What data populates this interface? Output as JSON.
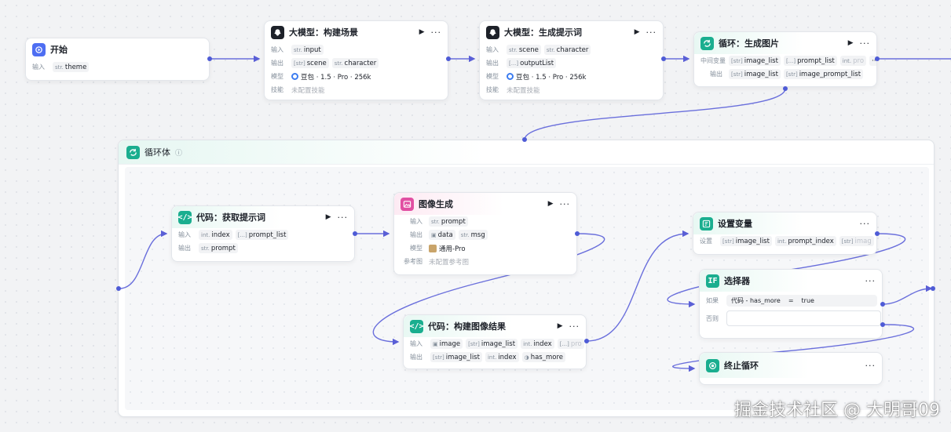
{
  "nodes": {
    "start": {
      "title": "开始",
      "input_label": "输入",
      "input_type": "str.",
      "input_var": "theme"
    },
    "llm_scene": {
      "title": "大模型：构建场景",
      "input_label": "输入",
      "input_type": "str.",
      "input_var": "input",
      "output_label": "输出",
      "out1_type": "[str]",
      "out1_var": "scene",
      "out2_type": "str.",
      "out2_var": "character",
      "model_label": "模型",
      "model": "豆包 · 1.5 · Pro · 256k",
      "skill_label": "技能",
      "skill": "未配置技能"
    },
    "llm_prompt": {
      "title": "大模型：生成提示词",
      "input_label": "输入",
      "in1_type": "str.",
      "in1_var": "scene",
      "in2_type": "str.",
      "in2_var": "character",
      "output_label": "输出",
      "out_type": "[...]",
      "out_var": "outputList",
      "model_label": "模型",
      "model": "豆包 · 1.5 · Pro · 256k",
      "skill_label": "技能",
      "skill": "未配置技能"
    },
    "loop": {
      "title": "循环：生成图片",
      "mid_label": "中间变量",
      "mid1_type": "[str]",
      "mid1_var": "image_list",
      "mid2_type": "[...]",
      "mid2_var": "prompt_list",
      "mid3_type": "int.",
      "mid3_var": "pro",
      "output_label": "输出",
      "out1_type": "[str]",
      "out1_var": "image_list",
      "out2_type": "[str]",
      "out2_var": "image_prompt_list"
    },
    "loop_body": {
      "title": "循环体"
    },
    "code_get": {
      "title": "代码：获取提示词",
      "input_label": "输入",
      "in1_type": "int.",
      "in1_var": "index",
      "in2_type": "[...]",
      "in2_var": "prompt_list",
      "output_label": "输出",
      "out_type": "str.",
      "out_var": "prompt"
    },
    "image_gen": {
      "title": "图像生成",
      "input_label": "输入",
      "in_type": "str.",
      "in_var": "prompt",
      "output_label": "输出",
      "out1_var": "data",
      "out2_type": "str.",
      "out2_var": "msg",
      "model_label": "模型",
      "model": "通用-Pro",
      "ref_label": "参考图",
      "ref": "未配置参考图"
    },
    "code_build": {
      "title": "代码：构建图像结果",
      "input_label": "输入",
      "in1_var": "image",
      "in2_type": "[str]",
      "in2_var": "image_list",
      "in3_type": "int.",
      "in3_var": "index",
      "in4_type": "[...]",
      "in4_var": "pro",
      "output_label": "输出",
      "out1_type": "[str]",
      "out1_var": "image_list",
      "out2_type": "int.",
      "out2_var": "index",
      "out3_var": "has_more"
    },
    "set_var": {
      "title": "设置变量",
      "set_label": "设置",
      "v1_type": "[str]",
      "v1_var": "image_list",
      "v2_type": "int.",
      "v2_var": "prompt_index",
      "v3_type": "[str]",
      "v3_var": "imag"
    },
    "selector": {
      "title": "选择器",
      "if_label": "如果",
      "cond_left": "代码 - has_more",
      "cond_op": "=",
      "cond_right": "true",
      "else_label": "否则"
    },
    "stop_loop": {
      "title": "终止循环"
    }
  },
  "icons": {
    "play": "▶",
    "more": "···",
    "info": "ⓘ"
  },
  "watermark": "掘金技术社区 @ 大明哥09"
}
